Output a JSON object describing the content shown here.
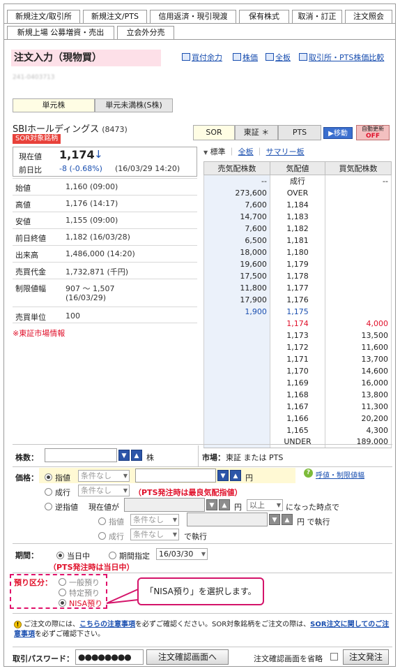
{
  "tabs_row1": [
    "新規注文/取引所",
    "新規注文/PTS",
    "信用返済・現引現渡",
    "保有株式",
    "取消・訂正",
    "注文照会"
  ],
  "tabs_row2": [
    "新規上場 公募増資・売出",
    "立会外分売"
  ],
  "header": {
    "title": "注文入力（現物買）",
    "links": [
      "買付余力",
      "株価",
      "全板",
      "取引所・PTS株価比較"
    ],
    "blurred_id": "241-0403713"
  },
  "unit_switch": {
    "unit": "単元株",
    "sub_unit": "単元未満株(S株)"
  },
  "stock": {
    "name": "SBIホールディングス",
    "code": "(8473)",
    "sor_badge": "SOR対象銘柄",
    "current_label": "現在値",
    "current_price": "1,174",
    "change_arrow": "↓",
    "prev_label": "前日比",
    "change": "-8 (-0.68%)",
    "change_time": "(16/03/29 14:20)"
  },
  "info_rows": [
    {
      "label": "始値",
      "value": "1,160 (09:00)"
    },
    {
      "label": "高値",
      "value": "1,176 (14:17)"
    },
    {
      "label": "安値",
      "value": "1,155 (09:00)"
    },
    {
      "label": "前日終値",
      "value": "1,182 (16/03/28)"
    },
    {
      "label": "出来高",
      "value": "1,486,000 (14:20)"
    },
    {
      "label": "売買代金",
      "value": "1,732,871 (千円)"
    },
    {
      "label": "制限値幅",
      "value": "907 ～ 1,507",
      "value2": "(16/03/29)"
    },
    {
      "label": "売買単位",
      "value": "100"
    }
  ],
  "market_note": "※東証市場情報",
  "market_tabs": {
    "sor": "SOR",
    "tse": "東証 ＊",
    "pts": "PTS",
    "move": "▶移動",
    "auto": "自動更新",
    "auto_state": "OFF"
  },
  "board_links": {
    "standard": "標準",
    "full": "全板",
    "summary": "サマリー板"
  },
  "board": {
    "headers": [
      "売気配株数",
      "気配値",
      "買気配株数"
    ],
    "rows": [
      [
        "--",
        "成行",
        "--"
      ],
      [
        "273,600",
        "OVER",
        ""
      ],
      [
        "7,600",
        "1,184",
        ""
      ],
      [
        "14,700",
        "1,183",
        ""
      ],
      [
        "7,600",
        "1,182",
        ""
      ],
      [
        "6,500",
        "1,181",
        ""
      ],
      [
        "18,000",
        "1,180",
        ""
      ],
      [
        "19,600",
        "1,179",
        ""
      ],
      [
        "17,500",
        "1,178",
        ""
      ],
      [
        "11,800",
        "1,177",
        ""
      ],
      [
        "17,900",
        "1,176",
        ""
      ],
      [
        "1,900",
        "1,175",
        ""
      ],
      [
        "",
        "1,174",
        "4,000"
      ],
      [
        "",
        "1,173",
        "13,500"
      ],
      [
        "",
        "1,172",
        "11,600"
      ],
      [
        "",
        "1,171",
        "13,700"
      ],
      [
        "",
        "1,170",
        "14,600"
      ],
      [
        "",
        "1,169",
        "16,000"
      ],
      [
        "",
        "1,168",
        "13,800"
      ],
      [
        "",
        "1,167",
        "11,300"
      ],
      [
        "",
        "1,166",
        "20,200"
      ],
      [
        "",
        "1,165",
        "4,300"
      ],
      [
        "",
        "UNDER",
        "189,000"
      ]
    ]
  },
  "form": {
    "qty_label": "株数：",
    "qty_unit": "株",
    "market_label": "市場：",
    "market_value": "東証 または PTS",
    "price_label": "価格：",
    "limit": "指値",
    "market_order": "成行",
    "stop": "逆指値",
    "cond_placeholder": "条件なし",
    "yen": "円",
    "pts_note": "（PTS発注時は最良気配指値）",
    "tick_link": "呼値・制限値幅",
    "stop_when": "現在値が",
    "above": "以上",
    "stop_trigger": "になった時点で",
    "sub_limit": "指値",
    "sub_market": "成行",
    "exec_yen": "円 で執行",
    "exec": "で執行",
    "period_label": "期間：",
    "today": "当日中",
    "period_spec": "期間指定",
    "date": "16/03/30",
    "period_note": "（PTS発注時は当日中）",
    "account_label": "預り区分：",
    "acct_general": "一般預り",
    "acct_specific": "特定預り",
    "acct_nisa": "NISA預り"
  },
  "callout": "「NISA預り」を選択します。",
  "notice": {
    "t1": "ご注文の際には、",
    "link1": "こちらの注意事項",
    "t2": "を必ずご確認ください。SOR対象銘柄をご注文の際は、",
    "link2": "SOR注文に関してのご注意事項",
    "t3": "を必ずご確認下さい。"
  },
  "password": {
    "label": "取引パスワード：",
    "value": "●●●●●●●●"
  },
  "buttons": {
    "confirm": "注文確認画面へ",
    "skip_label": "注文確認画面を省略",
    "send": "注文発注"
  },
  "colors": {
    "title_bg": "#fde0e8",
    "sell_bg": "#ebf1fa",
    "down_blue": "#1a4fb0",
    "red": "#e0102a",
    "accent": "#d4146a"
  }
}
